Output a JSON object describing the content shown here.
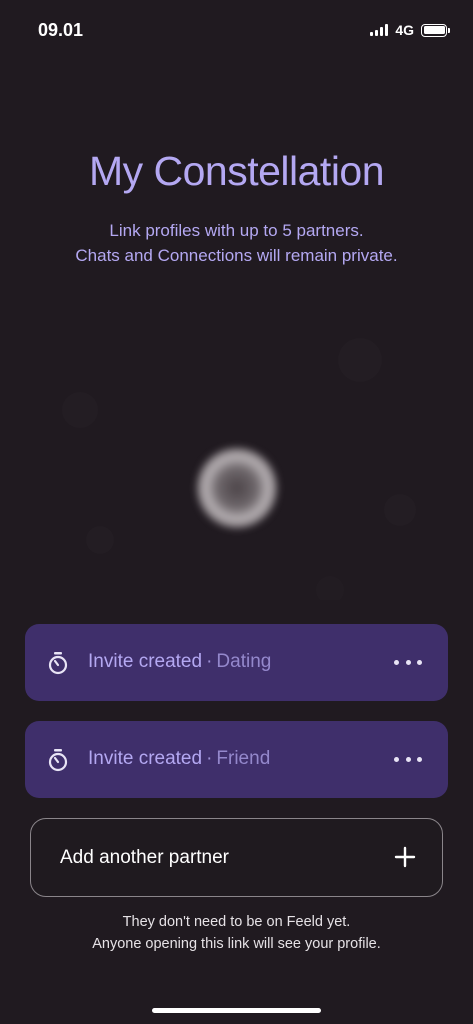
{
  "status_bar": {
    "time": "09.01",
    "network": "4G"
  },
  "header": {
    "title": "My Constellation",
    "subtitle_line1": "Link profiles with up to 5 partners.",
    "subtitle_line2": "Chats and Connections will remain private."
  },
  "invites": [
    {
      "status": "Invite created",
      "separator": "·",
      "type": "Dating"
    },
    {
      "status": "Invite created",
      "separator": "·",
      "type": "Friend"
    }
  ],
  "add_partner": {
    "label": "Add another partner"
  },
  "footnote": {
    "line1": "They don't need to be on Feeld yet.",
    "line2": "Anyone opening this link will see your profile."
  },
  "colors": {
    "background": "#201a20",
    "accent_text": "#b4a8f2",
    "card_background": "#3f2f6b"
  }
}
